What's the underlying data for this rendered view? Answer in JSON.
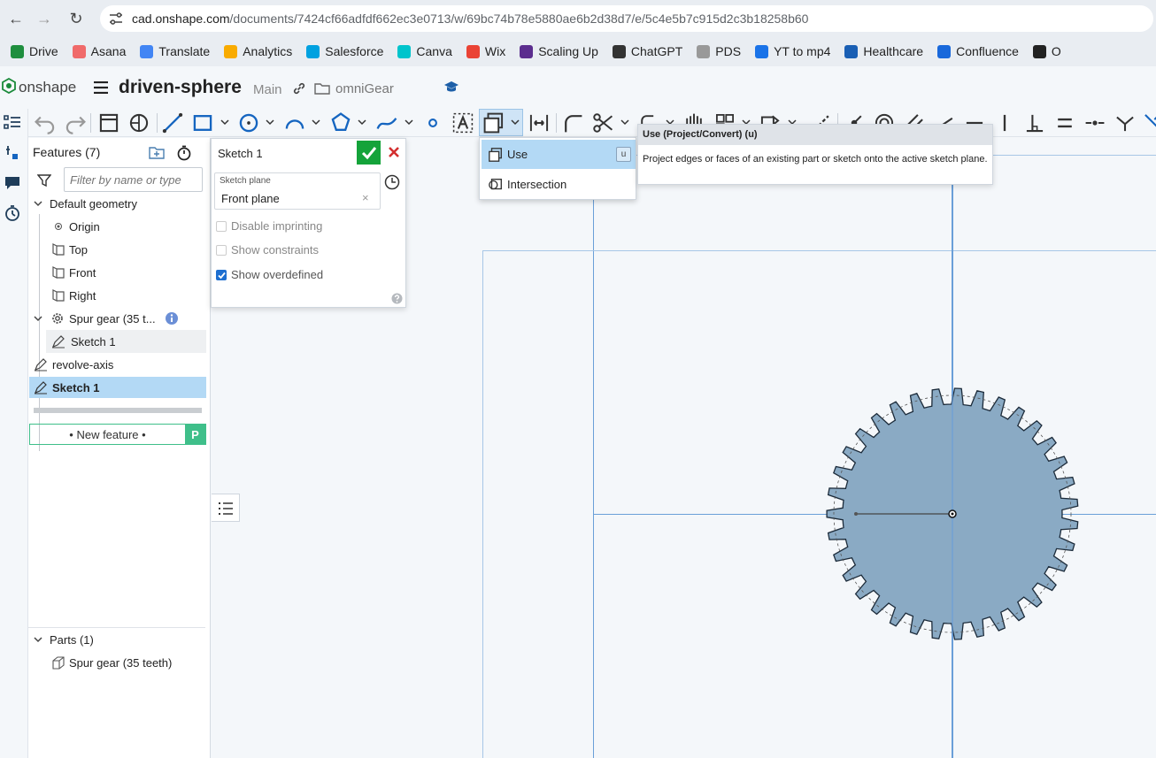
{
  "browser": {
    "url_host": "cad.onshape.com",
    "url_path": "/documents/7424cf66adfdf662ec3e0713/w/69bc74b78e5880ae6b2d38d7/e/5c4e5b7c915d2c3b18258b60",
    "bookmarks": [
      {
        "label": "Drive",
        "color": "#1e8e3e"
      },
      {
        "label": "Asana",
        "color": "#f06a6a"
      },
      {
        "label": "Translate",
        "color": "#4285f4"
      },
      {
        "label": "Analytics",
        "color": "#f9ab00"
      },
      {
        "label": "Salesforce",
        "color": "#00a1e0"
      },
      {
        "label": "Canva",
        "color": "#00c4cc"
      },
      {
        "label": "Wix",
        "color": "#ea4335"
      },
      {
        "label": "Scaling Up",
        "color": "#5b2d8e"
      },
      {
        "label": "ChatGPT",
        "color": "#333333"
      },
      {
        "label": "PDS",
        "color": "#999999"
      },
      {
        "label": "YT to mp4",
        "color": "#1a73e8"
      },
      {
        "label": "Healthcare",
        "color": "#1a5fb4"
      },
      {
        "label": "Confluence",
        "color": "#1868db"
      },
      {
        "label": "O",
        "color": "#222222"
      }
    ]
  },
  "app": {
    "logo_text": "onshape",
    "doc_title": "driven-sphere",
    "branch": "Main",
    "folder": "omniGear"
  },
  "features": {
    "header": "Features (7)",
    "filter_placeholder": "Filter by name or type",
    "default_geometry": "Default geometry",
    "origin": "Origin",
    "top": "Top",
    "front": "Front",
    "right": "Right",
    "spur_gear": "Spur gear (35 t...",
    "spur_sketch": "Sketch 1",
    "revolve_axis": "revolve-axis",
    "sketch1": "Sketch 1",
    "new_feature": "• New feature •",
    "new_feature_badge": "P",
    "parts_header": "Parts (1)",
    "part_item": "Spur gear (35 teeth)"
  },
  "sketch_dialog": {
    "title": "Sketch 1",
    "plane_label": "Sketch plane",
    "plane_value": "Front plane",
    "opt_disable_imprinting": "Disable imprinting",
    "opt_show_constraints": "Show constraints",
    "opt_show_overdefined": "Show overdefined",
    "show_overdefined_checked": true
  },
  "dropdown": {
    "items": [
      {
        "label": "Use",
        "shortcut": "u"
      },
      {
        "label": "Intersection"
      }
    ]
  },
  "tooltip": {
    "title": "Use (Project/Convert) (u)",
    "body": "Project edges or faces of an existing part or sketch onto the active sketch plane."
  },
  "colors": {
    "accent": "#1e88e5",
    "selected_row": "#b3d9f5",
    "confirm_green": "#14a33a",
    "cancel_red": "#d32f2f",
    "gear_fill": "#8aaac4",
    "sketch_line": "#6a9fd8"
  }
}
